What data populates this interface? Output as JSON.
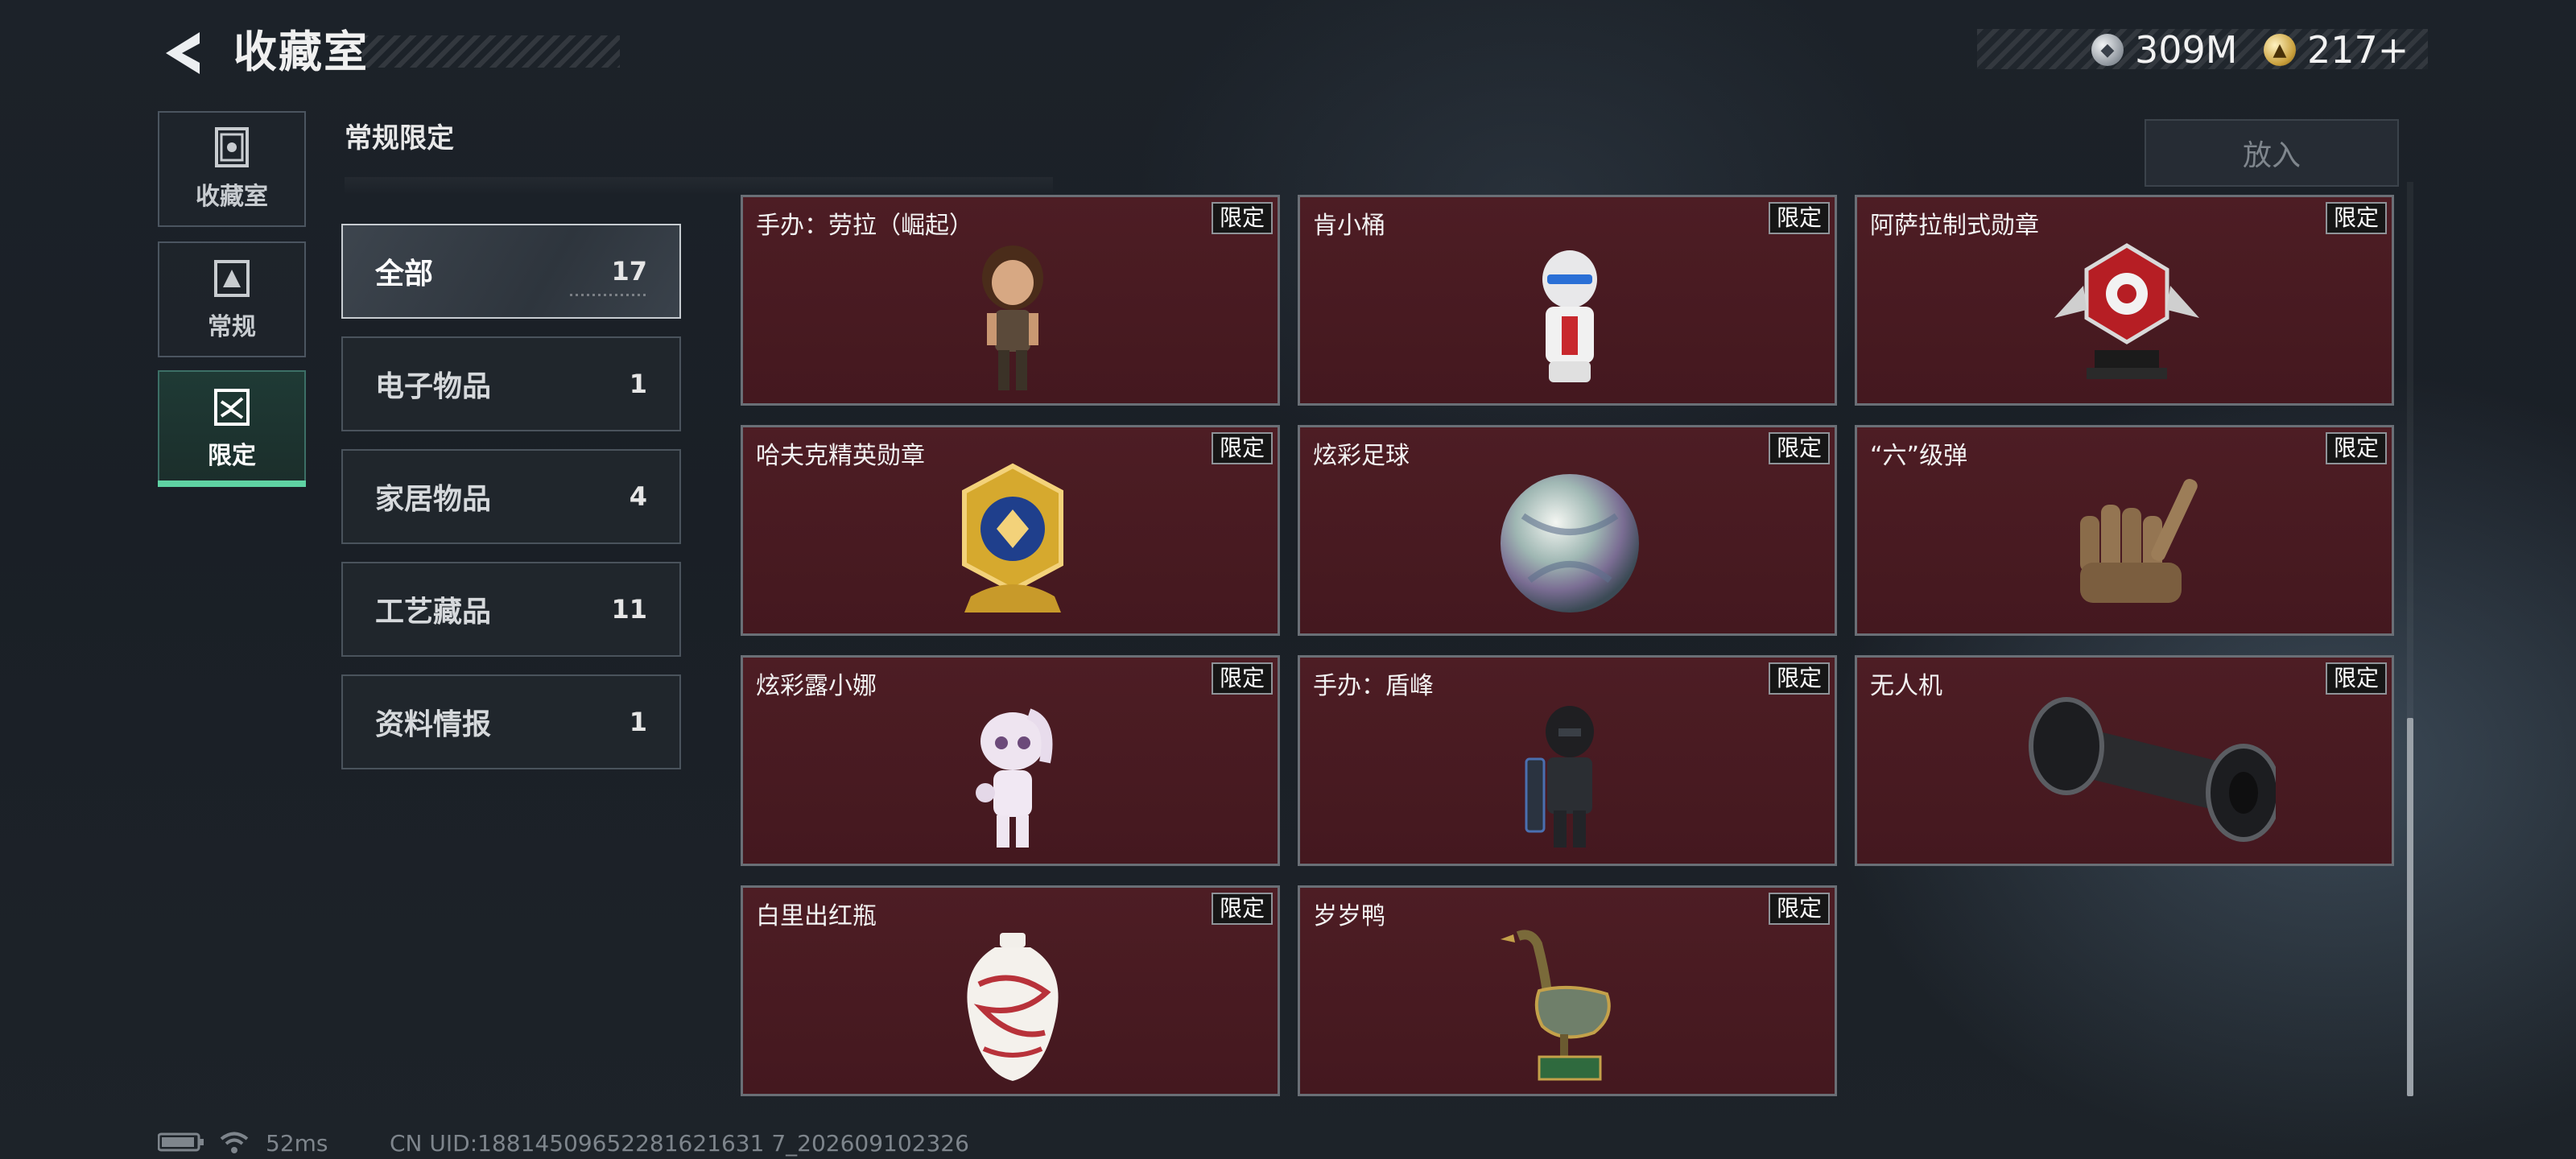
{
  "header": {
    "title": "收藏室",
    "back_icon": "back-arrow-icon"
  },
  "currency": [
    {
      "icon": "silver-coin-icon",
      "value": "309M"
    },
    {
      "icon": "gold-coin-icon",
      "value": "217+"
    }
  ],
  "nav": [
    {
      "label": "收藏室",
      "icon": "collection-icon",
      "active": false
    },
    {
      "label": "常规",
      "icon": "regular-icon",
      "active": false
    },
    {
      "label": "限定",
      "icon": "limited-icon",
      "active": true
    }
  ],
  "section_title": "常规限定",
  "categories": [
    {
      "name": "全部",
      "count": "17",
      "active": true
    },
    {
      "name": "电子物品",
      "count": "1",
      "active": false
    },
    {
      "name": "家居物品",
      "count": "4",
      "active": false
    },
    {
      "name": "工艺藏品",
      "count": "11",
      "active": false
    },
    {
      "name": "资料情报",
      "count": "1",
      "active": false
    }
  ],
  "put_button": "放入",
  "tag_label": "限定",
  "items": [
    {
      "name": "手办：劳拉（崛起）",
      "icon": "lara-figure-icon"
    },
    {
      "name": "肯小桶",
      "icon": "bucket-figure-icon"
    },
    {
      "name": "阿萨拉制式勋章",
      "icon": "red-medal-icon"
    },
    {
      "name": "哈夫克精英勋章",
      "icon": "gold-medal-icon"
    },
    {
      "name": "炫彩足球",
      "icon": "iridescent-ball-icon"
    },
    {
      "name": "“六”级弹",
      "icon": "hand-sculpture-icon"
    },
    {
      "name": "炫彩露小娜",
      "icon": "luna-figure-icon"
    },
    {
      "name": "手办：盾峰",
      "icon": "soldier-figure-icon"
    },
    {
      "name": "无人机",
      "icon": "drone-icon"
    },
    {
      "name": "白里出红瓶",
      "icon": "porcelain-vase-icon"
    },
    {
      "name": "岁岁鸭",
      "icon": "duck-statue-icon"
    }
  ],
  "status": {
    "battery_icon": "battery-icon",
    "wifi_icon": "wifi-icon",
    "ping": "52ms",
    "uid": "CN UID:18814509652281621631 7_202609102326"
  },
  "colors": {
    "accent_green": "#5fd2a3",
    "card_bg": "#4a1b22",
    "card_border": "#6a6f76"
  }
}
